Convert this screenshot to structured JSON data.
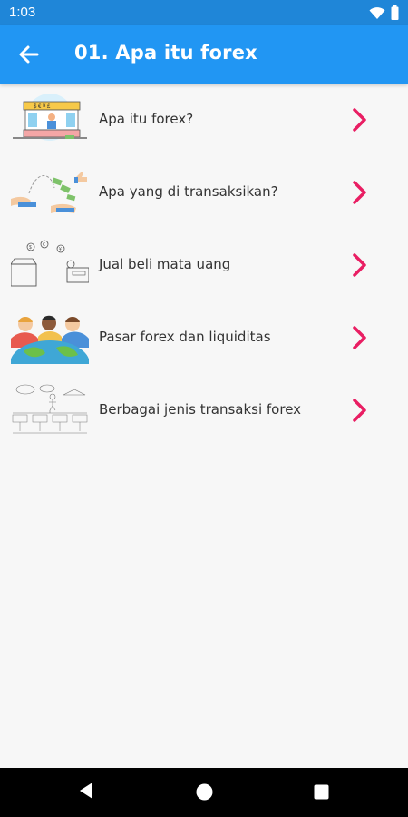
{
  "status_bar": {
    "time": "1:03",
    "icons": [
      "wifi-icon",
      "battery-icon"
    ]
  },
  "app_bar": {
    "title": "01. Apa itu forex",
    "back_icon": "arrow-back-icon",
    "color": "#2196f3"
  },
  "list": {
    "items": [
      {
        "label": "Apa itu forex?",
        "thumbnail": "currency-exchange-booth-illustration"
      },
      {
        "label": "Apa yang di transaksikan?",
        "thumbnail": "money-transfer-illustration"
      },
      {
        "label": "Jual beli mata uang",
        "thumbnail": "coins-and-wallets-sketch"
      },
      {
        "label": "Pasar forex dan liquiditas",
        "thumbnail": "people-around-globe-illustration"
      },
      {
        "label": "Berbagai jenis transaksi forex",
        "thumbnail": "transaction-types-sketch"
      }
    ],
    "chevron_icon": "chevron-right-icon",
    "chevron_color": "#e91e63"
  },
  "nav_bar": {
    "icons": [
      "back-triangle-icon",
      "home-circle-icon",
      "recents-square-icon"
    ]
  }
}
